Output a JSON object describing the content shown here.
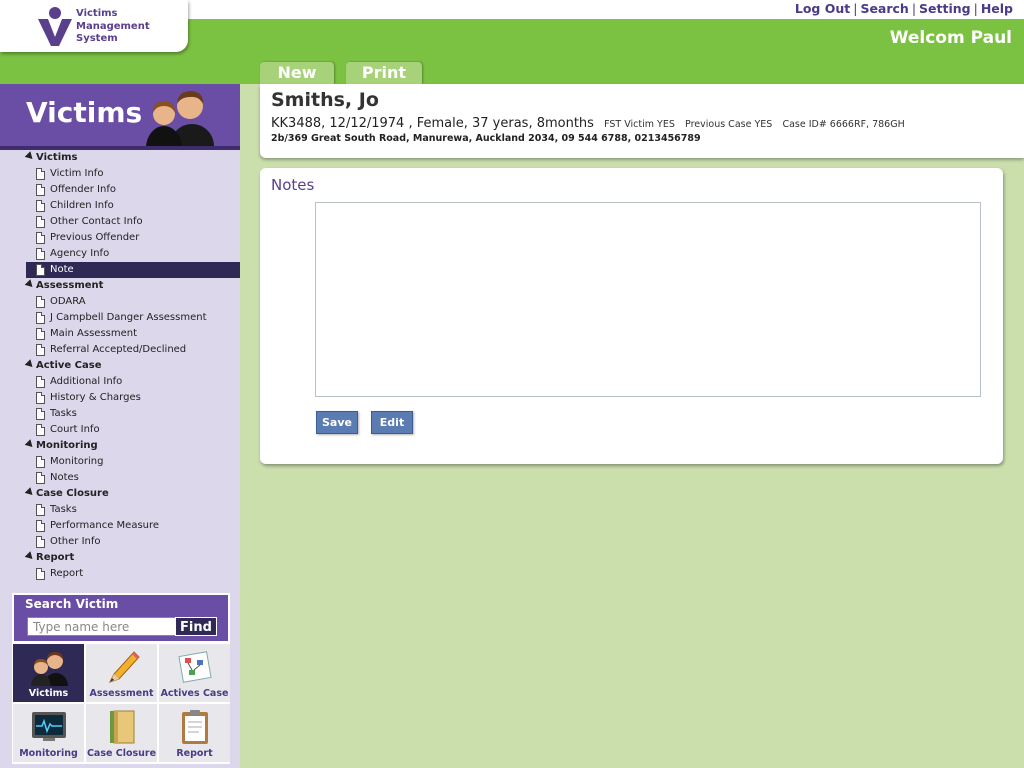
{
  "app": {
    "logo_lines": [
      "Victims",
      "Management",
      "System"
    ],
    "welcome": "Welcom Paul"
  },
  "top_links": [
    "Log Out",
    "Search",
    "Setting",
    "Help"
  ],
  "tabs": [
    "New",
    "Print"
  ],
  "sidebar": {
    "title": "Victims",
    "sections": [
      {
        "label": "Victims",
        "items": [
          "Victim Info",
          "Offender Info",
          "Children Info",
          "Other Contact Info",
          "Previous Offender",
          "Agency Info",
          "Note"
        ]
      },
      {
        "label": "Assessment",
        "items": [
          "ODARA",
          "J Campbell Danger Assessment",
          "Main Assessment",
          "Referral Accepted/Declined"
        ]
      },
      {
        "label": "Active Case",
        "items": [
          "Additional Info",
          "History & Charges",
          "Tasks",
          "Court Info"
        ]
      },
      {
        "label": "Monitoring",
        "items": [
          "Monitoring",
          "Notes"
        ]
      },
      {
        "label": "Case Closure",
        "items": [
          "Tasks",
          "Performance Measure",
          "Other Info"
        ]
      },
      {
        "label": "Report",
        "items": [
          "Report"
        ]
      }
    ],
    "active_item": "Note"
  },
  "search": {
    "label": "Search Victim",
    "placeholder": "Type name here",
    "button": "Find"
  },
  "shortcuts": [
    {
      "label": "Victims",
      "icon": "people-icon",
      "active": true
    },
    {
      "label": "Assessment",
      "icon": "pencil-icon",
      "active": false
    },
    {
      "label": "Actives Case",
      "icon": "chart-icon",
      "active": false
    },
    {
      "label": "Monitoring",
      "icon": "monitor-icon",
      "active": false
    },
    {
      "label": "Case Closure",
      "icon": "folder-icon",
      "active": false
    },
    {
      "label": "Report",
      "icon": "clipboard-icon",
      "active": false
    }
  ],
  "patient": {
    "name": "Smiths, Jo",
    "summary": "KK3488, 12/12/1974 , Female, 37 yeras, 8months",
    "fst": "FST Victim YES",
    "previous_case": "Previous Case YES",
    "case_id": "Case ID# 6666RF, 786GH",
    "address": "2b/369 Great South Road, Manurewa, Auckland 2034, 09 544 6788, 0213456789"
  },
  "notes": {
    "heading": "Notes",
    "value": "",
    "save_label": "Save",
    "edit_label": "Edit"
  },
  "colors": {
    "brand_purple": "#6a4ea5",
    "brand_green": "#7cc242",
    "background_green": "#cbdfad",
    "active_dark": "#2e2a55",
    "button_blue": "#5a7cb2"
  }
}
